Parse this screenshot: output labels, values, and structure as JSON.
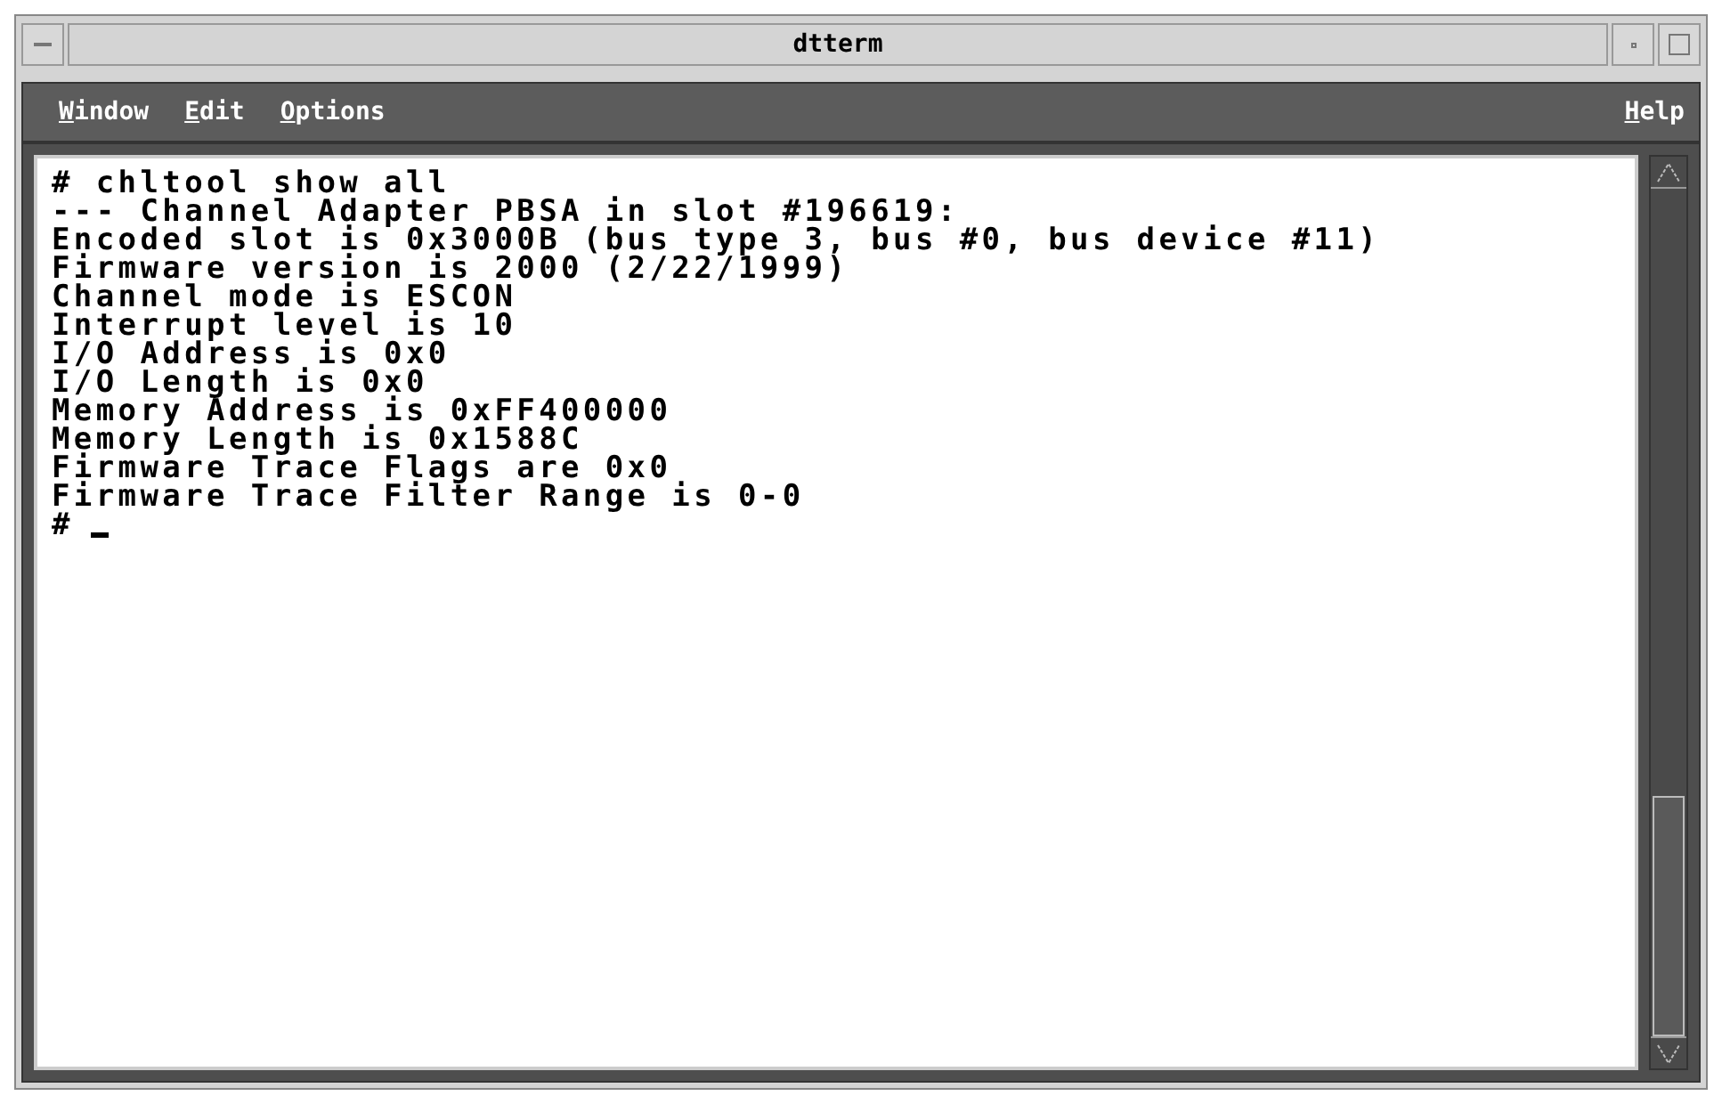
{
  "window": {
    "title": "dtterm"
  },
  "menu": [
    {
      "label": "Window"
    },
    {
      "label": "Edit"
    },
    {
      "label": "Options"
    }
  ],
  "help_menu": {
    "label": "Help"
  },
  "terminal": {
    "lines": [
      "# chltool show all",
      "--- Channel Adapter PBSA in slot #196619:",
      "Encoded slot is 0x3000B (bus type 3, bus #0, bus device #11)",
      "Firmware version is 2000 (2/22/1999)",
      "Channel mode is ESCON",
      "Interrupt level is 10",
      "I/O Address is 0x0",
      "I/O Length is 0x0",
      "Memory Address is 0xFF400000",
      "Memory Length is 0x1588C",
      "Firmware Trace Flags are 0x0",
      "Firmware Trace Filter Range is 0-0"
    ],
    "prompt": "#"
  }
}
